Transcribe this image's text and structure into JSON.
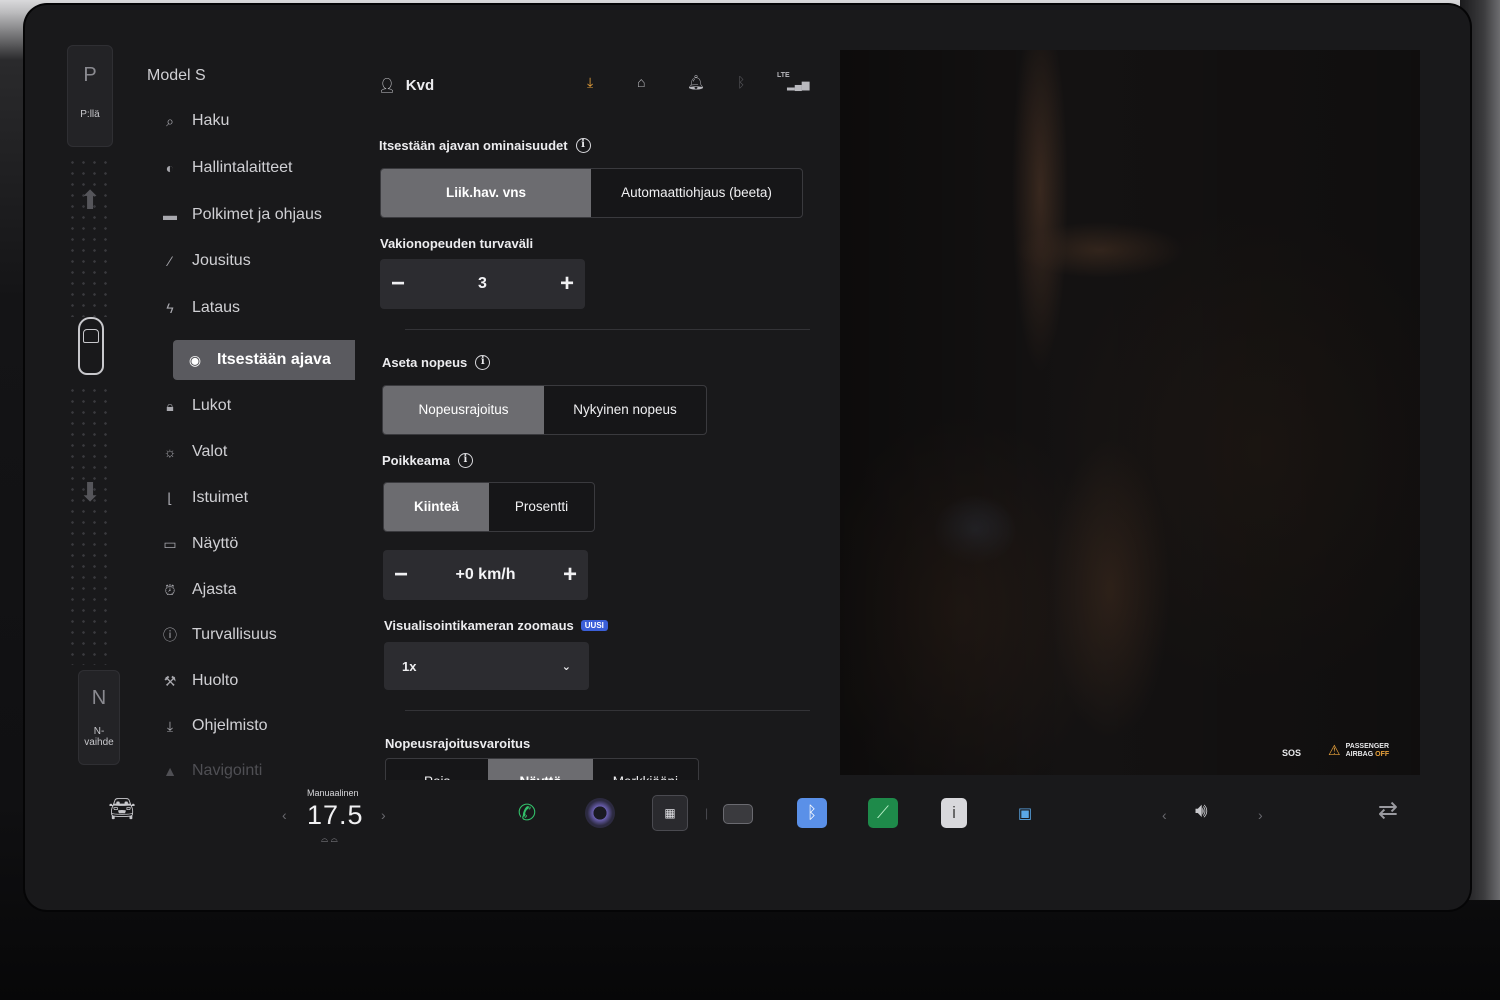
{
  "gear": {
    "top_letter": "P",
    "top_label": "P:llä",
    "bottom_letter": "N",
    "bottom_label_line1": "N-",
    "bottom_label_line2": "vaihde"
  },
  "sidebar": {
    "vehicle_name": "Model S",
    "items": [
      {
        "label": "Haku",
        "icon": "search-icon"
      },
      {
        "label": "Hallintalaitteet",
        "icon": "toggle-icon"
      },
      {
        "label": "Polkimet ja ohjaus",
        "icon": "car-icon"
      },
      {
        "label": "Jousitus",
        "icon": "wrench-icon"
      },
      {
        "label": "Lataus",
        "icon": "bolt-icon"
      },
      {
        "label": "Itsestään ajava",
        "icon": "steering-wheel-icon",
        "active": true
      },
      {
        "label": "Lukot",
        "icon": "lock-icon"
      },
      {
        "label": "Valot",
        "icon": "sun-icon"
      },
      {
        "label": "Istuimet",
        "icon": "seat-icon"
      },
      {
        "label": "Näyttö",
        "icon": "display-icon"
      },
      {
        "label": "Ajasta",
        "icon": "alarm-clock-icon"
      },
      {
        "label": "Turvallisuus",
        "icon": "alert-circle-icon"
      },
      {
        "label": "Huolto",
        "icon": "wrench-icon"
      },
      {
        "label": "Ohjelmisto",
        "icon": "download-icon"
      },
      {
        "label": "Navigointi",
        "icon": "navigation-icon"
      }
    ]
  },
  "topbar": {
    "profile_name": "Kvd",
    "lte_label": "LTE",
    "accent_color": "#e9a23b"
  },
  "autopilot": {
    "features_label": "Itsestään ajavan ominaisuudet",
    "features_options": [
      "Liik.hav. vns",
      "Automaattiohjaus (beeta)"
    ],
    "features_selected": 0,
    "following_label": "Vakionopeuden turvaväli",
    "following_value": "3",
    "set_speed_label": "Aseta nopeus",
    "set_speed_options": [
      "Nopeusrajoitus",
      "Nykyinen nopeus"
    ],
    "set_speed_selected": 0,
    "offset_label": "Poikkeama",
    "offset_options": [
      "Kiinteä",
      "Prosentti"
    ],
    "offset_selected": 0,
    "offset_value": "+0 km/h",
    "zoom_label": "Visualisointikameran zoomaus",
    "zoom_badge": "UUSI",
    "zoom_value": "1x",
    "speed_warning_label": "Nopeusrajoitusvaroitus",
    "speed_warning_options": [
      "Pois",
      "Näyttö",
      "Merkkiääni"
    ],
    "speed_warning_selected": 1
  },
  "camera": {
    "sos_label": "SOS",
    "airbag_line1": "PASSENGER",
    "airbag_line2_prefix": "AIRBAG",
    "airbag_line2_status": "OFF"
  },
  "bottombar": {
    "temp_mode": "Manuaalinen",
    "temp_value": "17.5",
    "icons": [
      "car-icon",
      "phone-icon",
      "camera-icon",
      "app-launcher-icon",
      "glovebox-icon",
      "bluetooth-icon",
      "energy-chart-icon",
      "manual-icon",
      "toybox-icon",
      "volume-icon",
      "swap-icon"
    ]
  }
}
